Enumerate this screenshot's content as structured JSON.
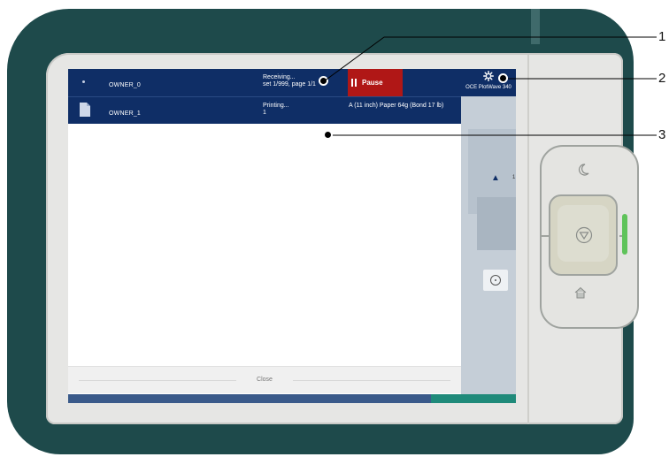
{
  "jobs": [
    {
      "owner": "OWNER_0",
      "status_line1": "Receiving...",
      "status_line2": "set 1/999, page 1/1",
      "action_label": "Pause",
      "media": ""
    },
    {
      "owner": "OWNER_1",
      "status_line1": "Printing...",
      "status_line2": "1",
      "media": "A (11 inch) Paper 64g (Bond 17 lb)"
    }
  ],
  "printer": {
    "name": "OCE PlotWave 340",
    "icon": "gear-icon"
  },
  "close_label": "Close",
  "callouts": [
    "1",
    "2",
    "3"
  ],
  "hardware": {
    "sleep_icon": "moon-icon",
    "stop_icon": "stop-icon",
    "home_icon": "home-icon",
    "led_color": "#5fc35a"
  },
  "colors": {
    "joblist_bg": "#0f2e66",
    "pause_bg": "#b01716",
    "device_body": "#1e4a4b"
  }
}
